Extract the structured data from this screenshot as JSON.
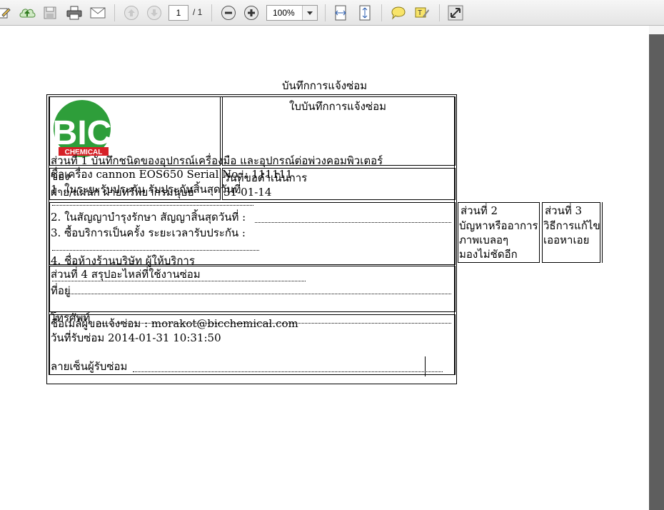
{
  "toolbar": {
    "icons": [
      "edit-icon",
      "upload-icon",
      "save-icon",
      "print-icon",
      "email-icon",
      "prev-page-icon",
      "next-page-icon",
      "zoom-out-icon",
      "zoom-in-icon",
      "fit-width-icon",
      "fit-page-icon",
      "comment-icon",
      "highlight-text-icon",
      "fullscreen-icon"
    ],
    "page_current": "1",
    "page_total": "/ 1",
    "zoom": "100%"
  },
  "document": {
    "header_title": "บันทึกการแจ้งซ่อม",
    "form_title": "ใบบันทึกการแจ้งซ่อม",
    "logo_text": "BIC",
    "logo_subtext": "CHEMICAL",
    "logo_colors": {
      "green": "#2e9e3a",
      "red": "#d62027"
    },
    "section1_title": "ส่วนที่ 1 บันทึกชนิดของอุปกรณ์เครื่องมือ และอุปกรณ์ต่อพ่วงคอมพิวเตอร์",
    "device_line": "ชื่อเครื่อง cannon EOS650 Serial No. : 111111",
    "owner_label": "ของ",
    "date_label": "วันที่ขอดำเนินการ",
    "warranty_line": "1. ในระยะรับประกัน รับประกันสิ้นสุดวันที่",
    "department_line": "ฝ่าย/แผนก ฝ่ายทรัพยากรมนุษย์",
    "date_value": "31-01-14",
    "contract_line": "2. ในสัญญาบำรุงรักษา สัญญาสิ้นสุดวันที่ :",
    "service_line": "3. ซื้อบริการเป็นครั้ง ระยะเวลารับประกัน :",
    "shop_line": "4. ชื่อห้างร้านบริษัท ผู้ให้บริการ",
    "section2_title": "ส่วนที่ 2",
    "section2_lines": [
      "บัญหาหรืออาการ",
      "ภาพเบลอๆ",
      "มองไม่ชัดอีก"
    ],
    "section3_title": "ส่วนที่ 3",
    "section3_lines": [
      "วิธีการแก้ไข",
      "เออหาเอย"
    ],
    "section4_title": "ส่วนที่ 4 สรุปอะไหล่ที่ใช้งานซ่อม",
    "address_label": "ที่อยู่",
    "phone_label": "โทรศัพท์",
    "reporter_line": "ชื่อเมล์ผู้ขอแจ้งซ่อม : morakot@bicchemical.com",
    "received_line": "วันที่รับซ่อม 2014-01-31 10:31:50",
    "signature_line": "ลายเซ็นผู้รับซ่อม"
  }
}
